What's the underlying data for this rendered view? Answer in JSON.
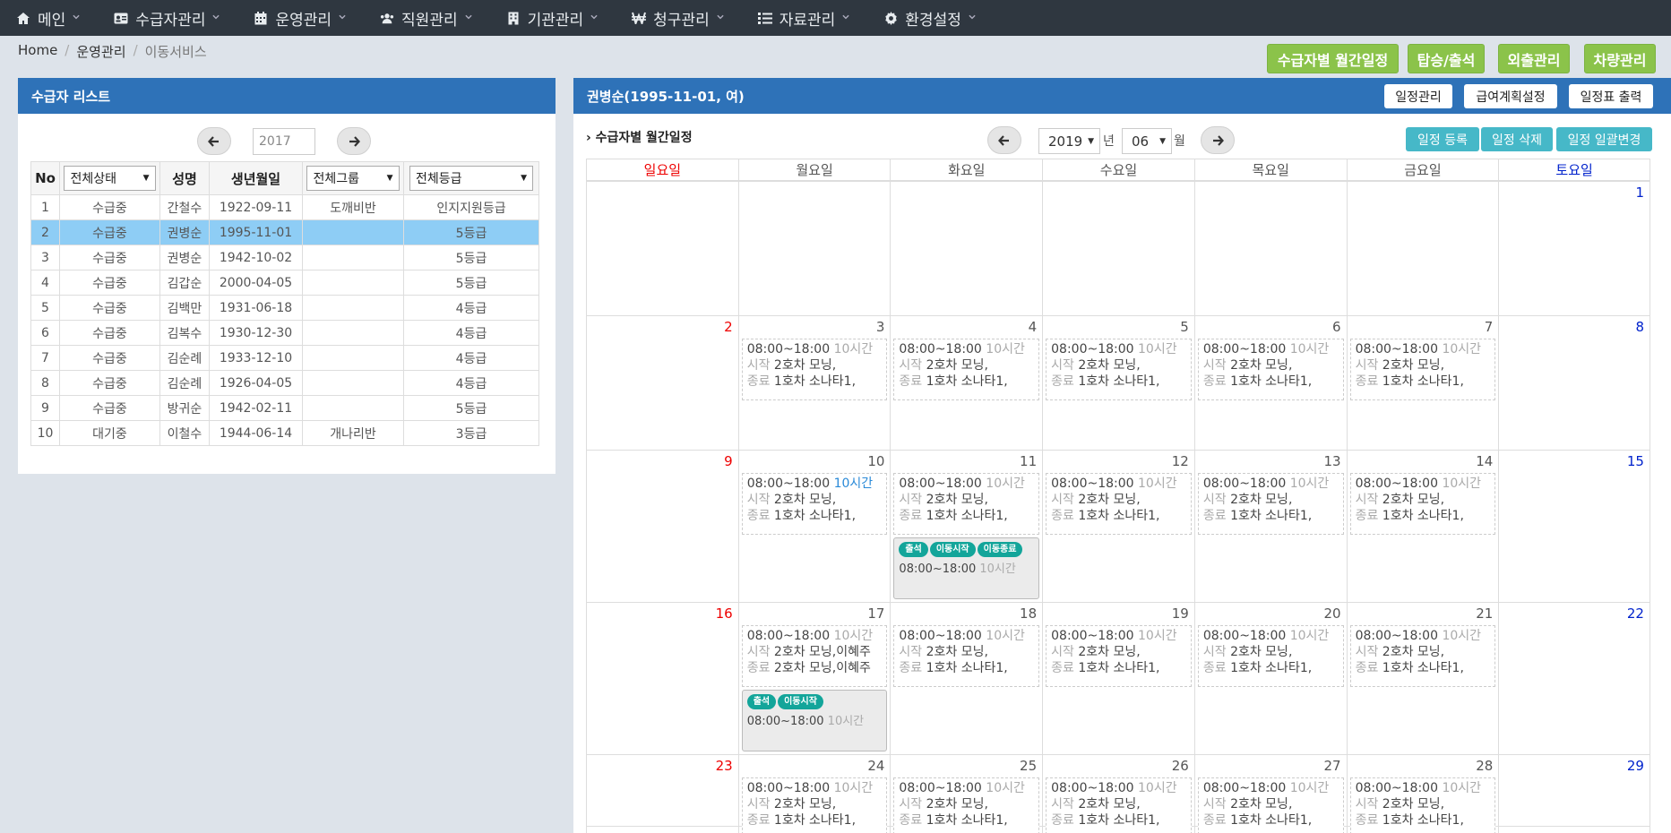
{
  "nav": [
    {
      "label": "메인",
      "icon": "home-icon"
    },
    {
      "label": "수급자관리",
      "icon": "id-card-icon"
    },
    {
      "label": "운영관리",
      "icon": "calendar-icon"
    },
    {
      "label": "직원관리",
      "icon": "users-icon"
    },
    {
      "label": "기관관리",
      "icon": "building-icon"
    },
    {
      "label": "청구관리",
      "icon": "won-icon"
    },
    {
      "label": "자료관리",
      "icon": "list-icon"
    },
    {
      "label": "환경설정",
      "icon": "gear-icon"
    }
  ],
  "breadcrumb": [
    "Home",
    "운영관리",
    "이동서비스"
  ],
  "top_buttons": [
    "수급자별 월간일정",
    "탑승/출석",
    "외출관리",
    "차량관리"
  ],
  "left_panel": {
    "title": "수급자 리스트",
    "year": "2017",
    "headers": {
      "no": "No",
      "status": "전체상태",
      "name": "성명",
      "birth": "생년월일",
      "group": "전체그룹",
      "grade": "전체등급"
    },
    "rows": [
      [
        "1",
        "수급중",
        "간철수",
        "1922-09-11",
        "도깨비반",
        "인지지원등급"
      ],
      [
        "2",
        "수급중",
        "권병순",
        "1995-11-01",
        "",
        "5등급"
      ],
      [
        "3",
        "수급중",
        "권병순",
        "1942-10-02",
        "",
        "5등급"
      ],
      [
        "4",
        "수급중",
        "김갑순",
        "2000-04-05",
        "",
        "5등급"
      ],
      [
        "5",
        "수급중",
        "김백만",
        "1931-06-18",
        "",
        "4등급"
      ],
      [
        "6",
        "수급중",
        "김복수",
        "1930-12-30",
        "",
        "4등급"
      ],
      [
        "7",
        "수급중",
        "김순례",
        "1933-12-10",
        "",
        "4등급"
      ],
      [
        "8",
        "수급중",
        "김순례",
        "1926-04-05",
        "",
        "4등급"
      ],
      [
        "9",
        "수급중",
        "방귀순",
        "1942-02-11",
        "",
        "5등급"
      ],
      [
        "10",
        "대기중",
        "이철수",
        "1944-06-14",
        "개나리반",
        "3등급"
      ]
    ],
    "selected_row": 1
  },
  "right_panel": {
    "title": "권병순(1995-11-01, 여)",
    "head_buttons": [
      "일정관리",
      "급여계획설정",
      "일정표 출력"
    ],
    "subtitle": "수급자별 월간일정",
    "year": "2019",
    "year_unit": "년",
    "month": "06",
    "month_unit": "월",
    "action_buttons": [
      "일정 등록",
      "일정 삭제",
      "일정 일괄변경"
    ],
    "weekdays": [
      "일요일",
      "월요일",
      "화요일",
      "수요일",
      "목요일",
      "금요일",
      "토요일"
    ],
    "event": {
      "time": "08:00~18:00",
      "duration": "10시간",
      "start_label": "시작",
      "start_value": "2호차 모닝,",
      "end_label": "종료",
      "end_value": "1호차 소나타1,"
    },
    "event_17": {
      "start_value": "2호차 모닝,이혜주",
      "end_value": "2호차 모닝,이혜주"
    },
    "badges_11": [
      "출석",
      "이동시작",
      "이동종료"
    ],
    "badges_17": [
      "출석",
      "이동시작"
    ],
    "weeks": [
      [
        "",
        "",
        "",
        "",
        "",
        "",
        "1"
      ],
      [
        "2",
        "3",
        "4",
        "5",
        "6",
        "7",
        "8"
      ],
      [
        "9",
        "10",
        "11",
        "12",
        "13",
        "14",
        "15"
      ],
      [
        "16",
        "17",
        "18",
        "19",
        "20",
        "21",
        "22"
      ],
      [
        "23",
        "24",
        "25",
        "26",
        "27",
        "28",
        "29"
      ]
    ]
  }
}
